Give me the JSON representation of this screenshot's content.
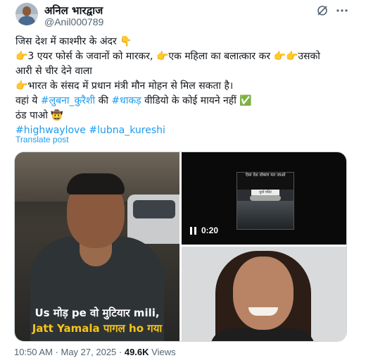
{
  "author": {
    "display_name": "अनिल भारद्वाज",
    "handle": "@Anil000789"
  },
  "header_icons": [
    "grok-icon",
    "more-options-icon"
  ],
  "tweet": {
    "lines": {
      "l1": "जिस देश में काश्मीर के अंदर 👇",
      "l2": "👉3 एयर फोर्स के जवानों को मारकर, 👉एक महिला का बलात्कार कर 👉👉उसको",
      "l3": "आरी से चीर देने वाला",
      "l4": "👉भारत के संसद में प्रधान मंत्री मौन मोहन से मिल सकता है।",
      "l5_before": "वहां ये ",
      "l5_tag1": "#लुबना_कुरैशी",
      "l5_mid": " की ",
      "l5_tag2": "#धाकड़",
      "l5_after": " वीडियो के कोई मायने नहीं ✅",
      "l6": "ठंड पाओ 🤠",
      "tag_highwaylove": "#highwaylove",
      "tag_lubna": "#lubna_kureshi"
    },
    "translate_label": "Translate post"
  },
  "media": {
    "left_caption_line1": "Us मोड़ pe वो मुटियार mili,",
    "left_caption_line2": "Jatt Yamala पागल ho गया",
    "video_time": "0:20",
    "video_thumb_title": "ऐसा देश दोबारा मत जाओ",
    "video_thumb_tag": "धुर्वा मंदिर"
  },
  "meta": {
    "time": "10:50 AM",
    "separator1": " · ",
    "date": "May 27, 2025",
    "separator2": " · ",
    "views_count": "49.6K",
    "views_label": " Views"
  }
}
